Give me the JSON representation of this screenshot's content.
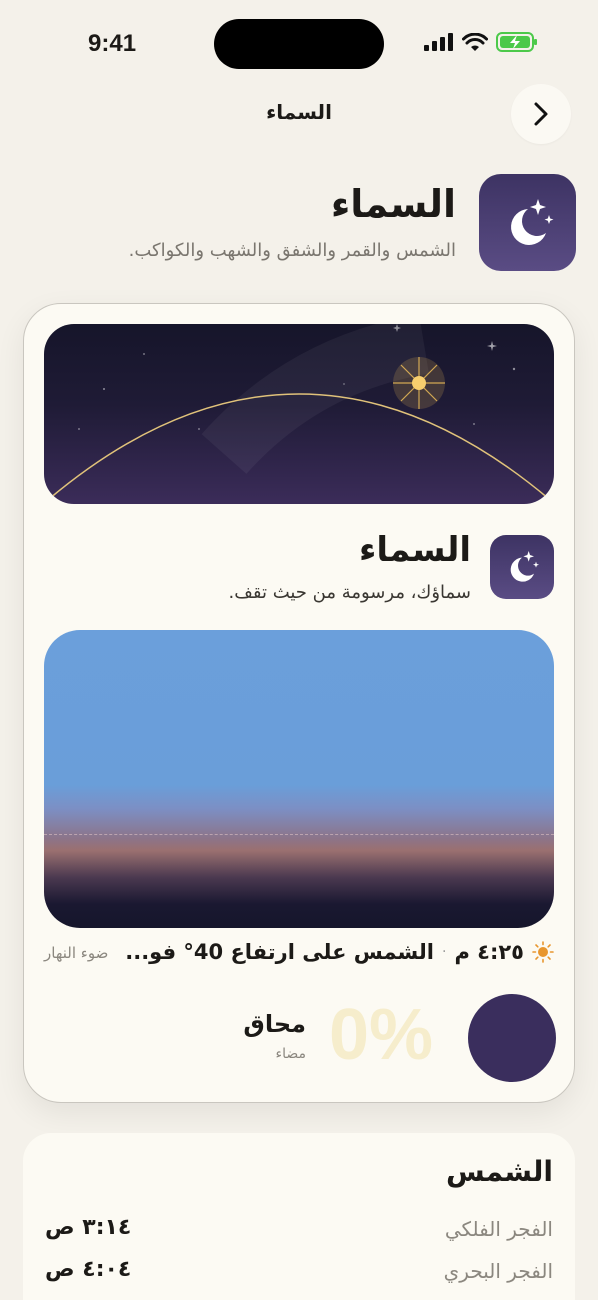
{
  "status_bar": {
    "time": "9:41"
  },
  "nav": {
    "title": "السماء"
  },
  "header": {
    "title": "السماء",
    "subtitle": "الشمس والقمر والشفق والشهب والكواكب."
  },
  "widget": {
    "title": "السماء",
    "subtitle": "سماؤك، مرسومة من حيث تقف.",
    "sun_time": "٤:٢٥ م",
    "separator": "·",
    "sun_altitude": "الشمس على ارتفاع 40° فو...",
    "daylight_label": "ضوء النهار",
    "moon": {
      "illumination": "0%",
      "phase_name": "محاق",
      "phase_sub": "مضاء"
    }
  },
  "sun_card": {
    "title": "الشمس",
    "rows": [
      {
        "label": "الفجر الفلكي",
        "value": "٣:١٤ ص"
      },
      {
        "label": "الفجر البحري",
        "value": "٤:٠٤ ص"
      }
    ]
  },
  "colors": {
    "background": "#f4f1ea",
    "card": "#fcfaf3",
    "app_icon": "#4a3f72",
    "moon_disc": "#3a2e5d",
    "sky_blue": "#6a9ed9",
    "sun_glow": "#f5c45a"
  }
}
